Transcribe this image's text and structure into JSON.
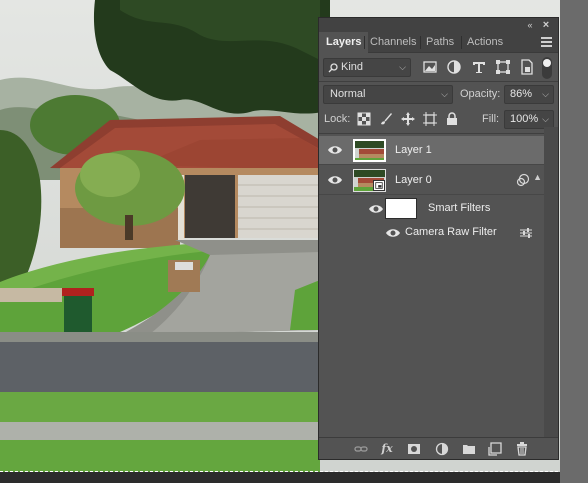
{
  "panel": {
    "tabs": [
      {
        "label": "Layers",
        "active": true
      },
      {
        "label": "Channels",
        "active": false
      },
      {
        "label": "Paths",
        "active": false
      },
      {
        "label": "Actions",
        "active": false
      }
    ],
    "collapse_glyph": "«",
    "close_glyph": "×"
  },
  "filter": {
    "kind_label": "Kind",
    "icons": [
      "pixel-filter-icon",
      "adjustment-filter-icon",
      "type-filter-icon",
      "shape-filter-icon",
      "smart-object-filter-icon"
    ]
  },
  "blend": {
    "mode": "Normal",
    "opacity_label": "Opacity:",
    "opacity_value": "86%"
  },
  "lock": {
    "label": "Lock:",
    "fill_label": "Fill:",
    "fill_value": "100%"
  },
  "layers": [
    {
      "name": "Layer 1",
      "selected": true,
      "visible": true
    },
    {
      "name": "Layer 0",
      "selected": false,
      "visible": true,
      "smart_object": true
    }
  ],
  "smart_filters": {
    "label": "Smart Filters",
    "filters": [
      {
        "name": "Camera Raw Filter"
      }
    ]
  },
  "footer": {
    "fx_label": "fx"
  },
  "colors": {
    "panel_bg": "#535353",
    "selected_row": "#6b6b6b",
    "tabbar_bg": "#424242"
  }
}
